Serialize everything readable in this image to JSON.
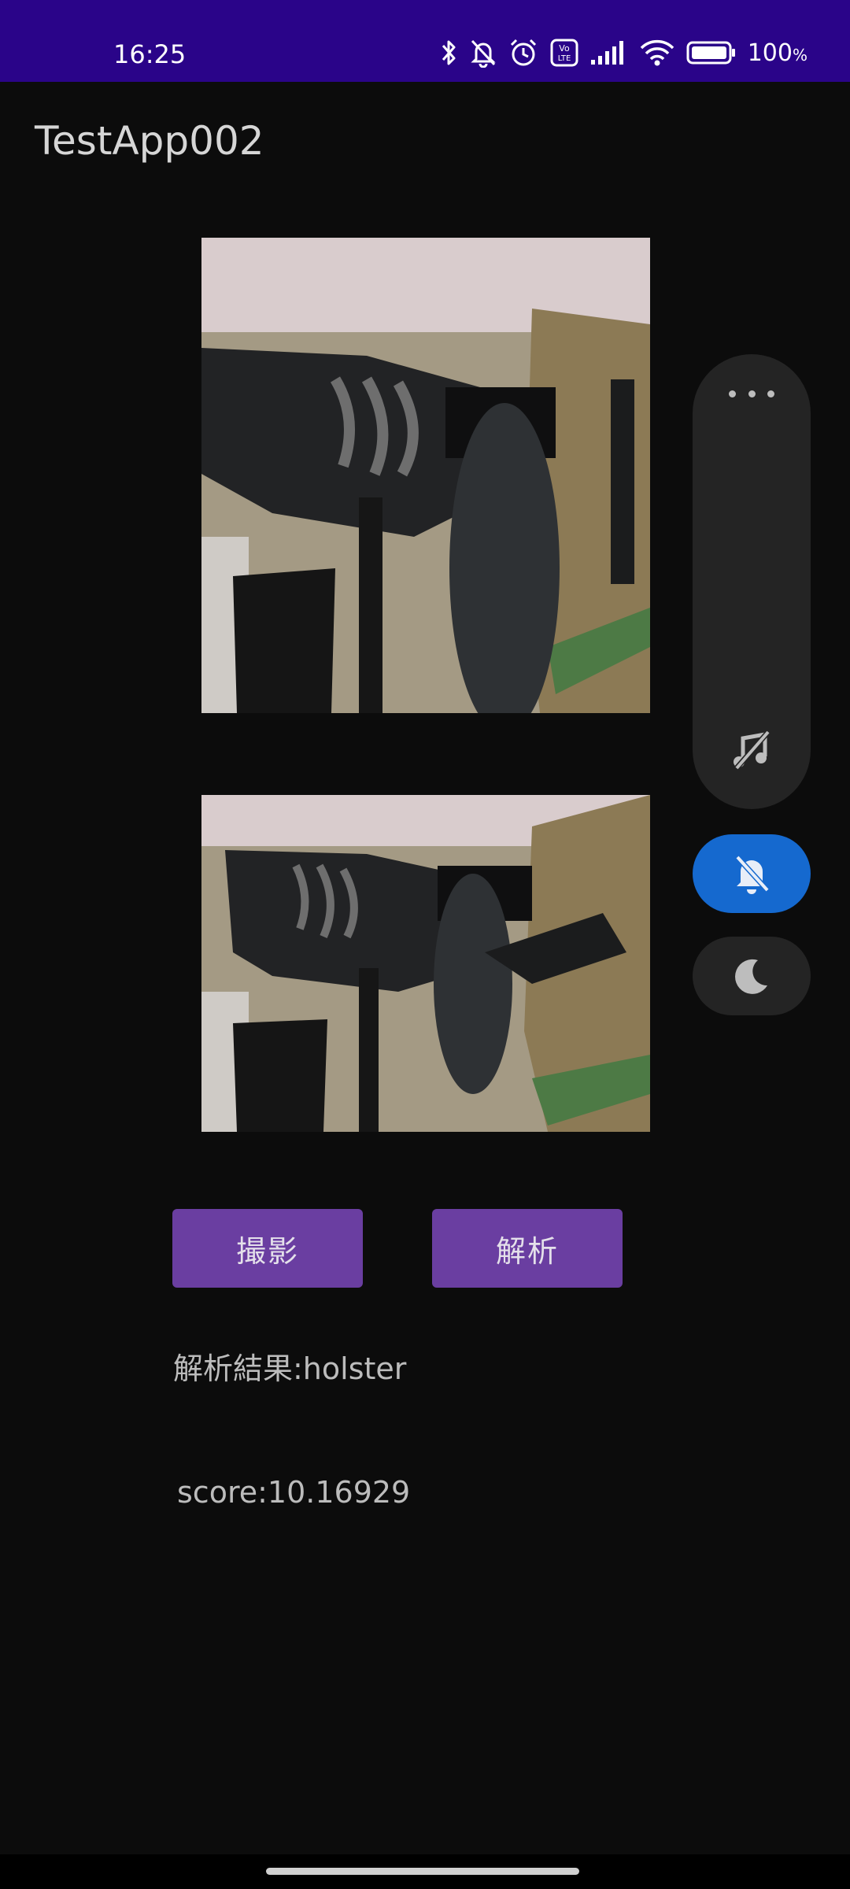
{
  "status_bar": {
    "time": "16:25",
    "battery_label": "100",
    "battery_unit": "%",
    "icons": [
      "bluetooth-icon",
      "bell-off-icon",
      "alarm-icon",
      "volte-icon",
      "signal-icon",
      "wifi-icon",
      "battery-icon"
    ],
    "background": "#2a0489"
  },
  "app": {
    "title": "TestApp002"
  },
  "images": {
    "captured": "captured-photo",
    "processed": "processed-photo"
  },
  "buttons": {
    "capture_label": "撮影",
    "analyze_label": "解析",
    "accent": "#6a3ea1"
  },
  "results": {
    "label_text": "解析結果:holster",
    "score_text": "score:10.16929"
  },
  "volume_panel": {
    "icons": [
      "more-icon",
      "music-off-icon",
      "bell-mute-icon",
      "moon-icon"
    ],
    "active_color": "#1569cf"
  }
}
